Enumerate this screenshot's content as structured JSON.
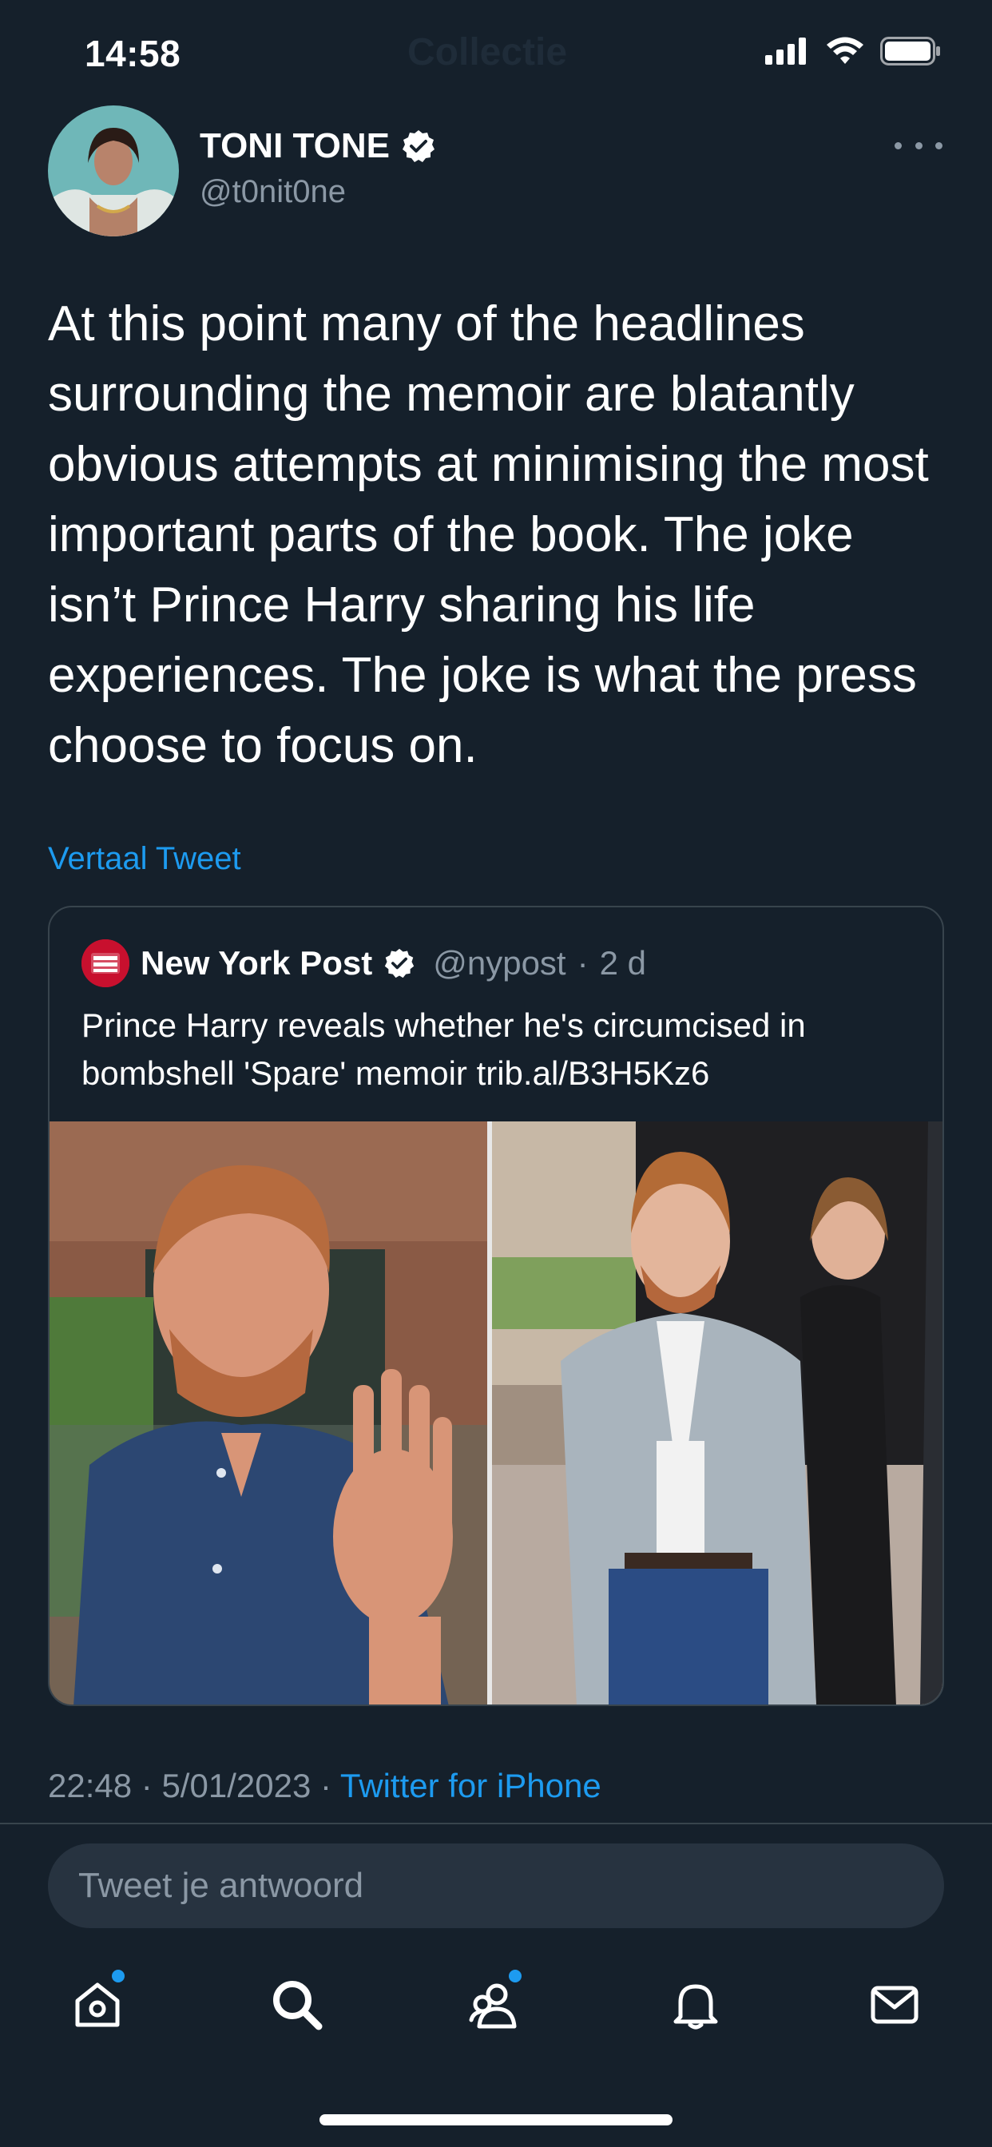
{
  "status_bar": {
    "time": "14:58",
    "ghost_title": "Collectie",
    "icons": [
      "signal-icon",
      "wifi-icon",
      "battery-icon"
    ]
  },
  "author": {
    "name": "TONI TONE",
    "handle": "@t0nit0ne",
    "verified": true
  },
  "tweet": {
    "text": "At this point many of the headlines surrounding the memoir are blatantly obvious attempts at minimising the most important parts of the book. The joke isn’t Prince Harry sharing his life experiences. The joke is what the press choose to focus on.",
    "translate_label": "Vertaal Tweet",
    "time": "22:48",
    "date": "5/01/2023",
    "separator": "·",
    "source": "Twitter for iPhone"
  },
  "quote": {
    "logo_text": "NEW YORK POST",
    "name": "New York Post",
    "handle": "@nypost",
    "age": "2 d",
    "text": "Prince Harry reveals whether he's circumcised in bombshell 'Spare' memoir trib.al/B3H5Kz6"
  },
  "reply": {
    "placeholder": "Tweet je antwoord"
  },
  "nav": {
    "items": [
      "home-icon",
      "search-icon",
      "communities-icon",
      "notifications-icon",
      "messages-icon"
    ],
    "badges": [
      "home",
      "communities"
    ]
  },
  "colors": {
    "background": "#15202b",
    "accent": "#1d9bf0",
    "secondary_text": "#8b98a5",
    "border": "#38444d",
    "nypost_red": "#c8102e"
  }
}
